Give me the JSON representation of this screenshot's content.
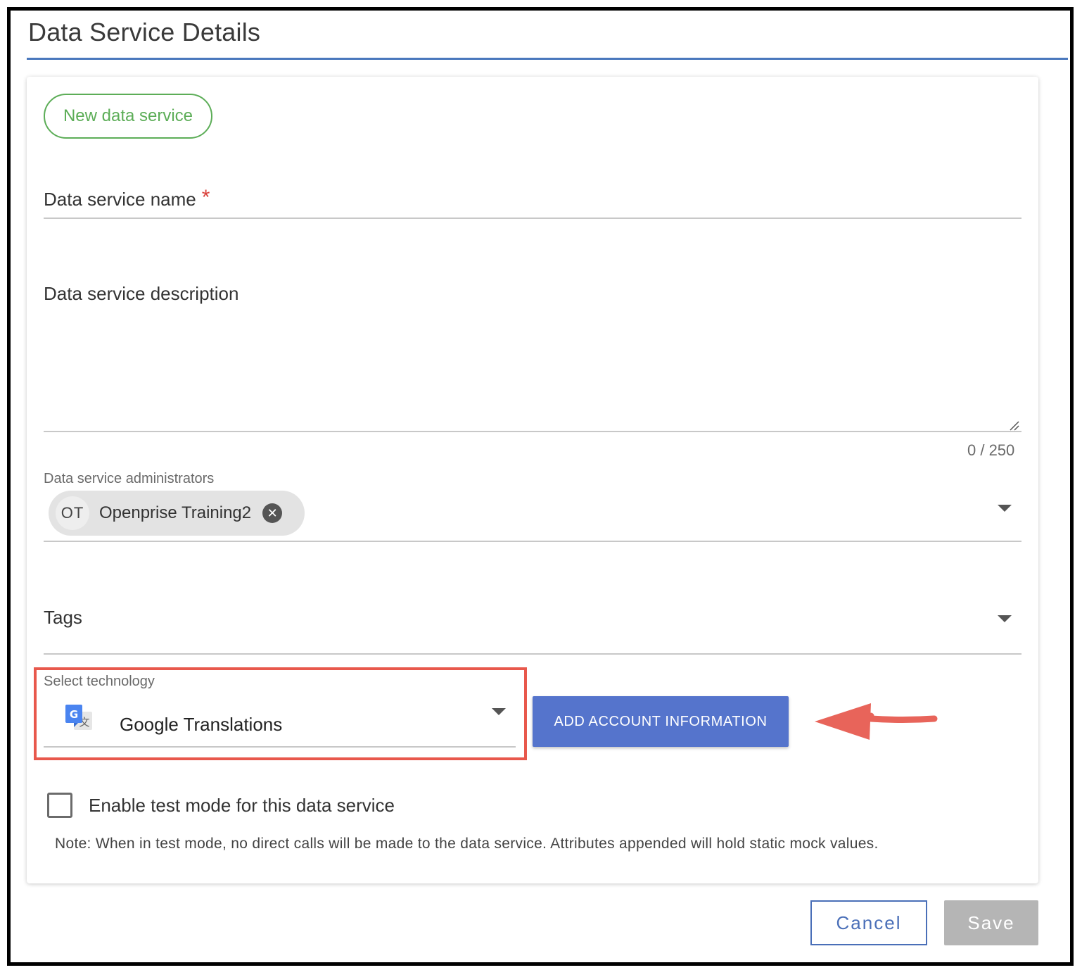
{
  "page": {
    "title": "Data Service Details"
  },
  "form": {
    "new_button": "New data service",
    "name_label": "Data service name",
    "required_mark": "*",
    "description_label": "Data service description",
    "description_counter": "0 / 250",
    "admins_label": "Data service administrators",
    "admins": [
      {
        "initials": "OT",
        "name": "Openprise Training2"
      }
    ],
    "tags_label": "Tags",
    "technology_label": "Select technology",
    "technology_value": "Google Translations",
    "technology_icon": "google-translate-icon",
    "add_account_button": "ADD ACCOUNT INFORMATION",
    "test_mode_label": "Enable test mode for this data service",
    "test_mode_checked": false,
    "note": "Note: When in test mode, no direct calls will be made to the data service. Attributes appended will hold static mock values."
  },
  "footer": {
    "cancel": "Cancel",
    "save": "Save"
  },
  "colors": {
    "accent_blue": "#4a78bd",
    "primary_button": "#5574cc",
    "green": "#5cad57",
    "highlight_red": "#e8584c",
    "disabled": "#b5b5b5"
  }
}
